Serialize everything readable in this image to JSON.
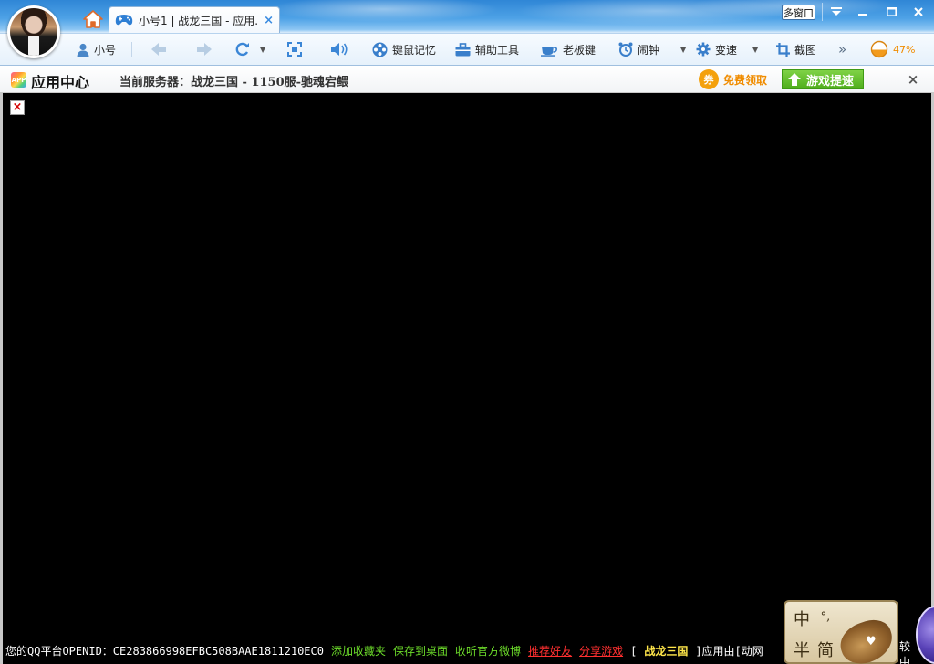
{
  "window": {
    "multi_window_label": "多窗口",
    "controls": [
      "dropdown",
      "minimize",
      "maximize",
      "close"
    ]
  },
  "tab": {
    "title": "小号1 | 战龙三国 - 应用...",
    "close_glyph": "×"
  },
  "toolbar": {
    "account_label": "小号",
    "items": [
      {
        "label": "键鼠记忆",
        "icon": "film-reel-icon"
      },
      {
        "label": "辅助工具",
        "icon": "toolbox-icon"
      },
      {
        "label": "老板键",
        "icon": "teacup-icon"
      },
      {
        "label": "闹钟",
        "icon": "alarm-clock-icon"
      },
      {
        "label": "变速",
        "icon": "gear-icon"
      },
      {
        "label": "截图",
        "icon": "crop-icon"
      }
    ],
    "more_glyph": "»",
    "progress_label": "47%",
    "progress_value": 0.47
  },
  "app_bar": {
    "logo_text": "APP",
    "title": "应用中心",
    "server_info": "当前服务器：战龙三国 - 1150服-驰魂宕鳂",
    "coupon_glyph": "券",
    "free_claim": "免费领取",
    "speedup": "游戏提速",
    "close_glyph": "×"
  },
  "game": {
    "broken_image_glyph": "×"
  },
  "status_bar": {
    "openid": "您的QQ平台OPENID：CE283866998EFBC508BAAE1811210EC0",
    "add_favorites": "添加收藏夹",
    "save_desktop": "保存到桌面",
    "follow_weibo": "收听官方微博",
    "recommend_friends": "推荐好友",
    "share_game": "分享游戏",
    "provider_prefix": "[",
    "game_name": "战龙三国",
    "provider_suffix": "]应用由[动网",
    "tail": "较中"
  },
  "ime": {
    "top_left": "中",
    "top_mid": "°,",
    "bottom_left": "半",
    "bottom_mid": "简"
  },
  "colors": {
    "accent_blue": "#3a8be0",
    "link_green": "#6cdb2a",
    "link_red": "#ff3030",
    "game_name_yellow": "#ffe64a",
    "coupon_orange": "#f4a10c",
    "speedup_green": "#4fae1c"
  }
}
